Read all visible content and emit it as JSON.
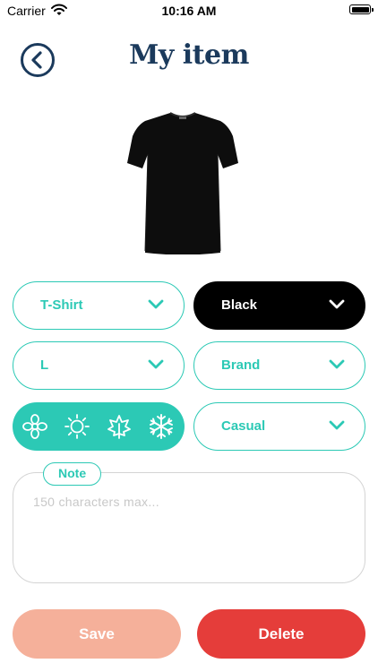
{
  "status_bar": {
    "carrier": "Carrier",
    "time": "10:16 AM"
  },
  "header": {
    "title": "My item",
    "back_icon": "back-arrow-circle-icon"
  },
  "item": {
    "image": "black-tshirt"
  },
  "fields": {
    "category": "T-Shirt",
    "color": "Black",
    "size": "L",
    "brand": "Brand",
    "style": "Casual"
  },
  "seasons": [
    "spring-flower-icon",
    "summer-sun-icon",
    "autumn-leaf-icon",
    "winter-snowflake-icon"
  ],
  "note": {
    "label": "Note",
    "placeholder": "150 characters max..."
  },
  "actions": {
    "save": "Save",
    "delete": "Delete"
  },
  "colors": {
    "accent": "#2cc9b5",
    "title": "#1b3a5c",
    "save": "#f5b09a",
    "delete": "#e53d3a"
  }
}
